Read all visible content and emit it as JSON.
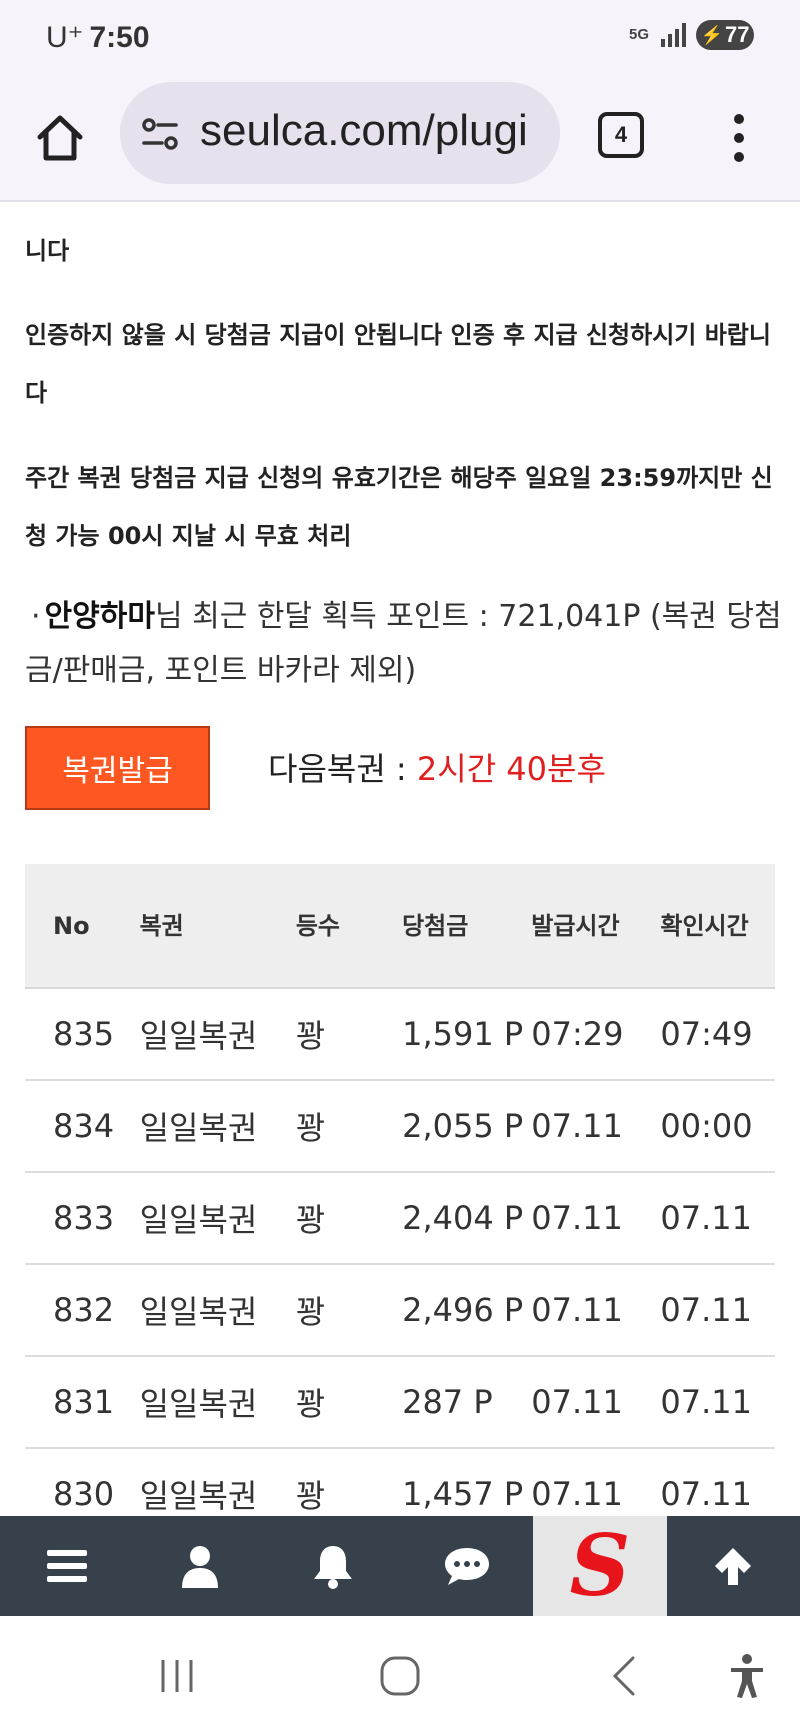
{
  "status_bar": {
    "carrier": "U⁺",
    "time": "7:50",
    "network": "5G",
    "battery": "77"
  },
  "browser": {
    "url": "seulca.com/plugi",
    "tab_count": "4",
    "icons": [
      "home-icon",
      "site-settings-icon",
      "tabs-icon",
      "more-vert-icon"
    ]
  },
  "notices": {
    "line1": "니다",
    "line2": "인증하지 않을 시 당첨금 지급이 안됩니다 인증 후 지급 신청하시기 바랍니다",
    "line3": "주간 복권 당첨금 지급 신청의 유효기간은 해당주 일요일 23:59까지만 신청 가능 00시 지날 시 무효 처리"
  },
  "points": {
    "bullet": "·",
    "user": "안양하마",
    "text": "님 최근 한달 획득 포인트 : 721,041P (복권 당첨금/판매금, 포인트 바카라 제외)"
  },
  "issue": {
    "button_label": "복권발급",
    "next_label": "다음복권 : ",
    "next_value": "2시간 40분후",
    "button_color": "#ff5722",
    "highlight_color": "#e02020"
  },
  "table": {
    "headers": {
      "no": "No",
      "lottery": "복권",
      "rank": "등수",
      "prize": "당첨금",
      "issued": "발급시간",
      "checked": "확인시간"
    },
    "rows": [
      {
        "no": "835",
        "lottery": "일일복권",
        "rank": "꽝",
        "prize": "1,591 P",
        "issued": "07:29",
        "checked": "07:49"
      },
      {
        "no": "834",
        "lottery": "일일복권",
        "rank": "꽝",
        "prize": "2,055 P",
        "issued": "07.11",
        "checked": "00:00"
      },
      {
        "no": "833",
        "lottery": "일일복권",
        "rank": "꽝",
        "prize": "2,404 P",
        "issued": "07.11",
        "checked": "07.11"
      },
      {
        "no": "832",
        "lottery": "일일복권",
        "rank": "꽝",
        "prize": "2,496 P",
        "issued": "07.11",
        "checked": "07.11"
      },
      {
        "no": "831",
        "lottery": "일일복권",
        "rank": "꽝",
        "prize": "287 P",
        "issued": "07.11",
        "checked": "07.11"
      },
      {
        "no": "830",
        "lottery": "일일복권",
        "rank": "꽝",
        "prize": "1,457 P",
        "issued": "07.11",
        "checked": "07.11"
      }
    ]
  },
  "site_nav": {
    "items": [
      "menu-icon",
      "user-icon",
      "bell-icon",
      "chat-icon",
      "site-logo",
      "arrow-up-icon"
    ],
    "logo_letter": "S",
    "bg_color": "#37414b",
    "logo_color": "#e8141c"
  },
  "system_nav": {
    "items": [
      "recent-apps-icon",
      "home-circle-icon",
      "back-icon",
      "accessibility-icon"
    ]
  }
}
